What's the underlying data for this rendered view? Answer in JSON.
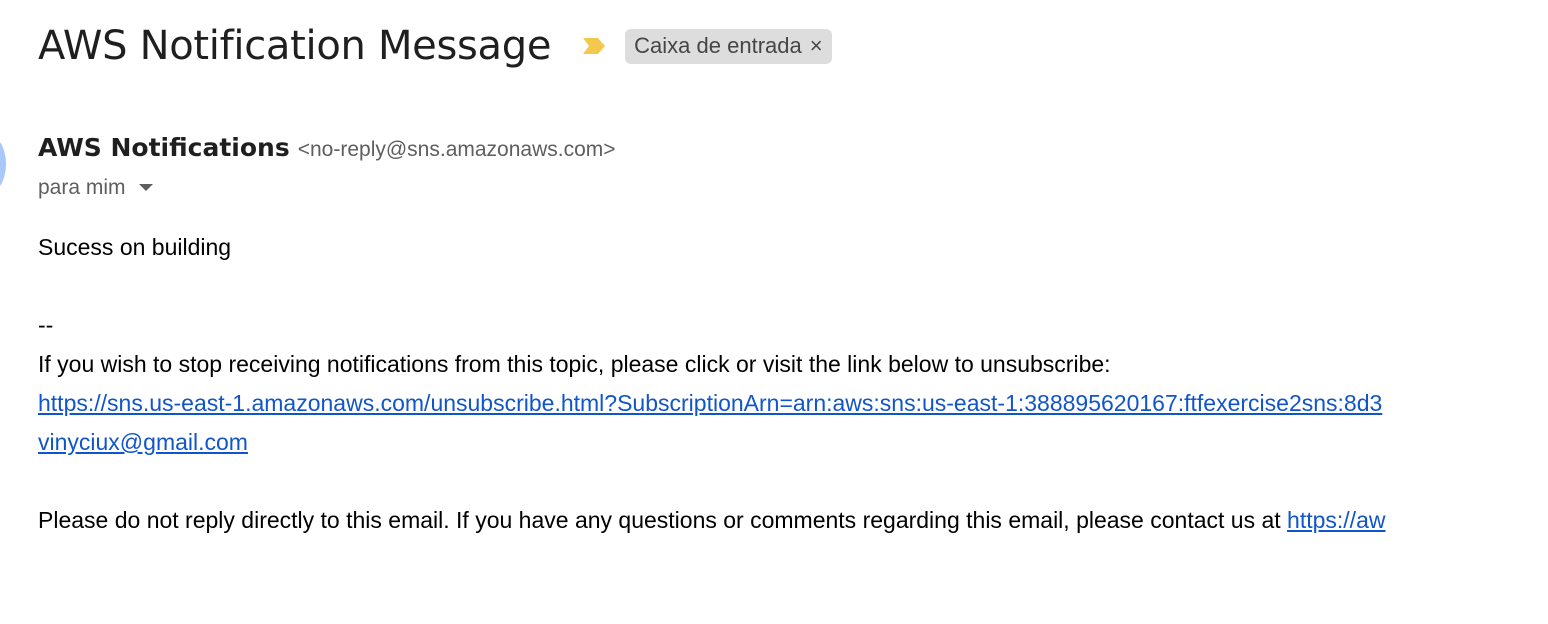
{
  "header": {
    "subject": "AWS Notification Message",
    "label_chip": {
      "text": "Caixa de entrada",
      "close_glyph": "×"
    },
    "importance_icon": "importance-marker-icon",
    "importance_color": "#f2c94c"
  },
  "sender": {
    "name": "AWS Notifications",
    "email": "<no-reply@sns.amazonaws.com>",
    "avatar_color": "#a8c7fa"
  },
  "recipient": {
    "label": "para mim",
    "icon": "caret-down-icon"
  },
  "message": {
    "line1": "Sucess on building",
    "separator": "--",
    "unsubscribe_notice": "If you wish to stop receiving notifications from this topic, please click or visit the link below to unsubscribe:",
    "unsubscribe_link": "https://sns.us-east-1.amazonaws.com/unsubscribe.html?SubscriptionArn=arn:aws:sns:us-east-1:388895620167:ftfexercise2sns:8d3",
    "email_link": "vinyciux@gmail.com",
    "footer_text": "Please do not reply directly to this email. If you have any questions or comments regarding this email, please contact us at",
    "footer_link": "https://aw"
  },
  "colors": {
    "link": "#1155cc",
    "chip_background": "#dddddd",
    "muted_text": "#5e5e5e"
  }
}
